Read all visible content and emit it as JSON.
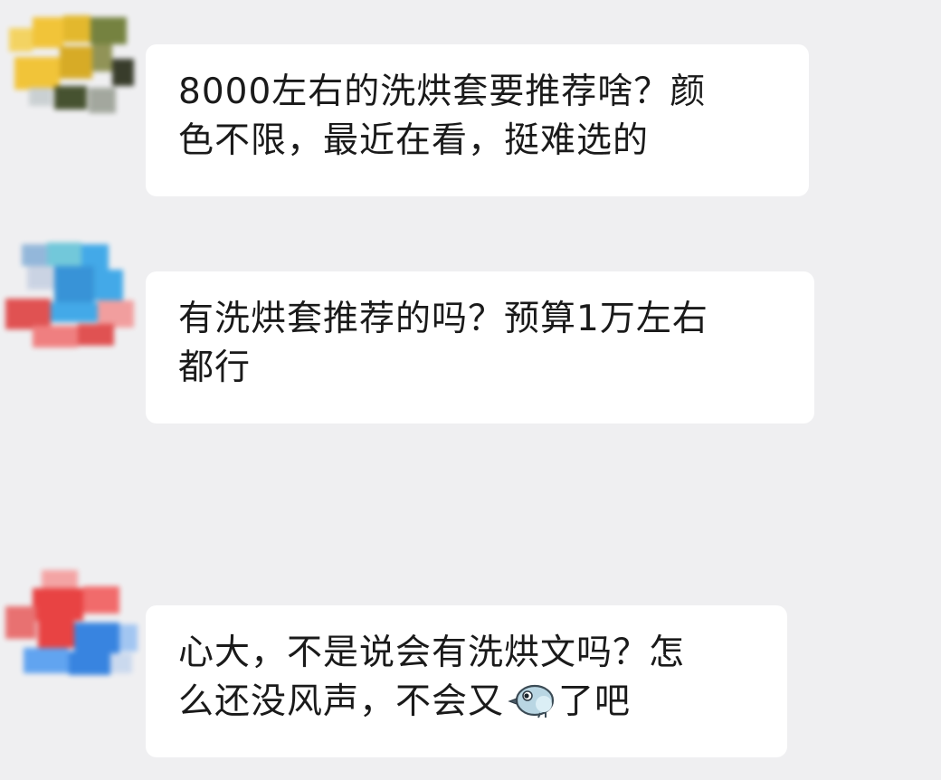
{
  "messages": [
    {
      "id": "m1",
      "lines": [
        "8000左右的洗烘套要推荐啥？颜",
        "色不限，最近在看，挺难选的"
      ],
      "avatar_colors": [
        "#f2c230",
        "#d6a81c",
        "#6f7d37",
        "#3e4a26",
        "#f4d25b",
        "#8c8f4f",
        "#2f3321",
        "#c9cfd1"
      ]
    },
    {
      "id": "m2",
      "lines": [
        "有洗烘套推荐的吗？预算1万左右",
        "都行"
      ],
      "avatar_colors": [
        "#3aa6e8",
        "#2f8fd6",
        "#e04a4a",
        "#f07a7a",
        "#8fb5d9",
        "#6cc6d9",
        "#c9d2e3",
        "#f29a9a"
      ]
    },
    {
      "id": "m3",
      "lines": [
        "心大，不是说会有洗烘文吗？怎",
        "么还没风声，不会又",
        "了吧"
      ],
      "emoji": "bird-icon",
      "avatar_colors": [
        "#e83a3a",
        "#f26464",
        "#2f7fe0",
        "#5aa0f0",
        "#f4a0a0",
        "#c9d8ee",
        "#e86b6b",
        "#9ec4f2"
      ]
    }
  ]
}
